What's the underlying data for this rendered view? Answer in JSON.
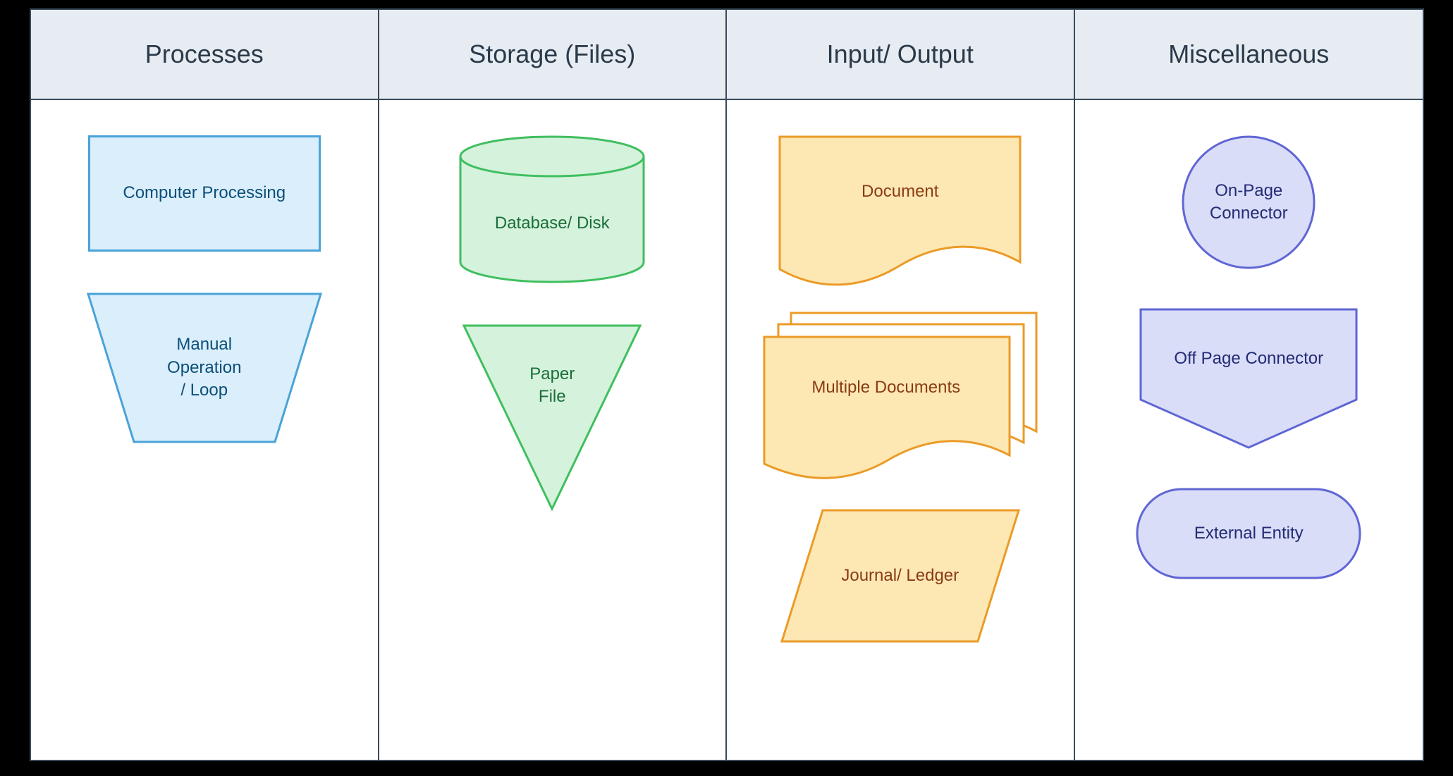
{
  "columns": [
    {
      "title": "Processes"
    },
    {
      "title": "Storage (Files)"
    },
    {
      "title": "Input/ Output"
    },
    {
      "title": "Miscellaneous"
    }
  ],
  "shapes": {
    "computer_processing": "Computer Processing",
    "manual_operation": "Manual\nOperation\n/ Loop",
    "database_disk": "Database/ Disk",
    "paper_file": "Paper\nFile",
    "document": "Document",
    "multiple_documents": "Multiple Documents",
    "journal_ledger": "Journal/ Ledger",
    "on_page_connector": "On-Page\nConnector",
    "off_page_connector": "Off Page Connector",
    "external_entity": "External Entity"
  }
}
